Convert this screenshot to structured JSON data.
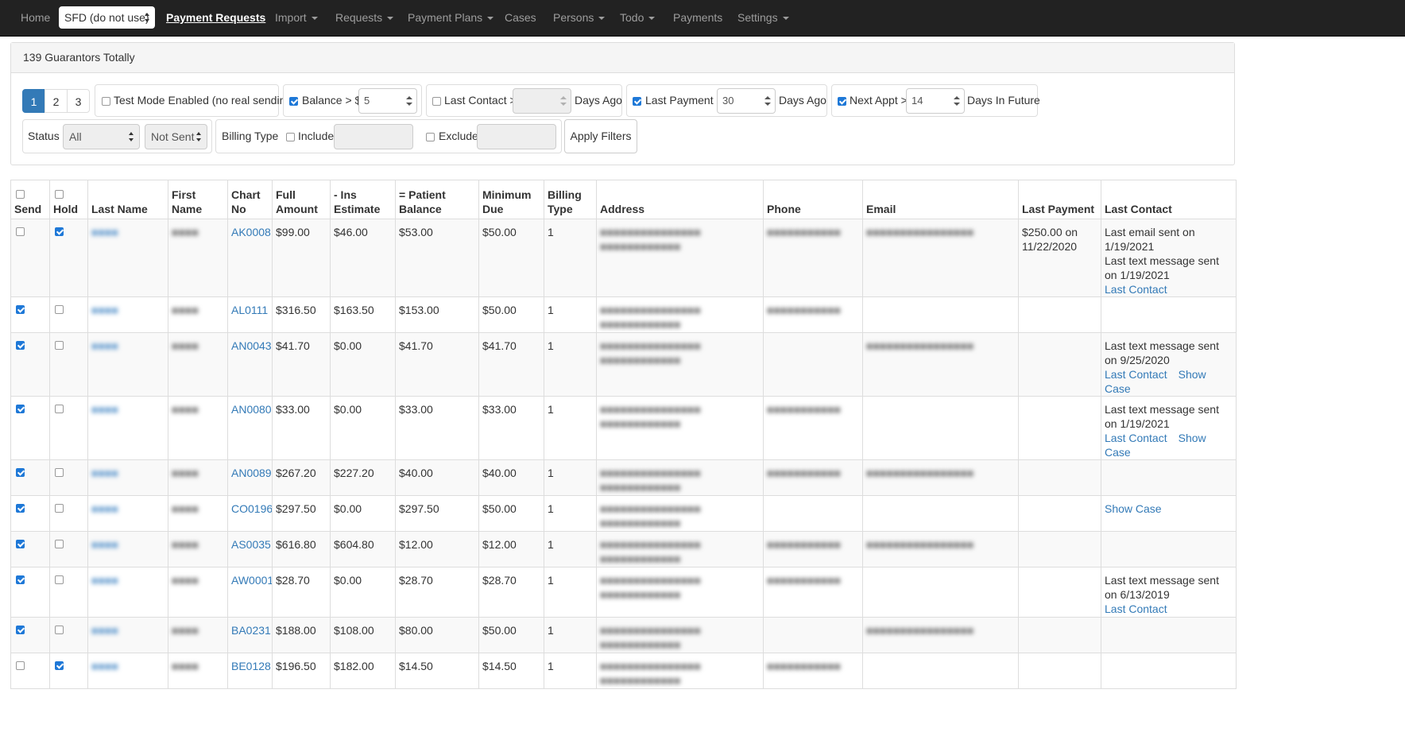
{
  "nav": {
    "home": "Home",
    "site_select": "SFD (do not use)",
    "payment_requests": "Payment Requests",
    "import": "Import",
    "requests": "Requests",
    "payment_plans": "Payment Plans",
    "cases": "Cases",
    "persons": "Persons",
    "todo": "Todo",
    "payments": "Payments",
    "settings": "Settings"
  },
  "panel": {
    "heading": "139 Guarantors Totally",
    "pages": [
      "1",
      "2",
      "3"
    ],
    "active_page": "1",
    "test_mode": {
      "label": "Test Mode Enabled (no real sending)",
      "checked": false
    },
    "balance": {
      "label": "Balance > $",
      "value": "5",
      "checked": true
    },
    "last_contact": {
      "label": "Last Contact >",
      "value": "",
      "suffix": "Days Ago",
      "checked": false
    },
    "last_payment": {
      "label": "Last Payment >",
      "value": "30",
      "suffix": "Days Ago",
      "checked": true
    },
    "next_appt": {
      "label": "Next Appt >",
      "value": "14",
      "suffix": "Days In Future",
      "checked": true
    },
    "status": {
      "label": "Status",
      "value": "All",
      "send_value": "Not Sent"
    },
    "billing_type": {
      "label": "Billing Type",
      "include_label": "Include",
      "exclude_label": "Exclude"
    },
    "apply": "Apply Filters"
  },
  "table": {
    "headers": {
      "send": "Send",
      "hold": "Hold",
      "last_name": "Last Name",
      "first_name": "First Name",
      "chart_no_1": "Chart",
      "chart_no_2": "No",
      "full_amount_1": "Full",
      "full_amount_2": "Amount",
      "ins_estimate_1": "- Ins",
      "ins_estimate_2": "Estimate",
      "patient_balance_1": "= Patient",
      "patient_balance_2": "Balance",
      "minimum_due_1": "Minimum",
      "minimum_due_2": "Due",
      "billing_type_1": "Billing",
      "billing_type_2": "Type",
      "address": "Address",
      "phone": "Phone",
      "email": "Email",
      "last_payment": "Last Payment",
      "last_contact": "Last Contact"
    },
    "rows": [
      {
        "send": false,
        "hold": true,
        "chart": "AK0008",
        "full": "$99.00",
        "ins": "$46.00",
        "patient": "$53.00",
        "min": "$50.00",
        "billing": "1",
        "last_payment": "$250.00 on 11/22/2020",
        "contact_lines": [
          "Last email sent on 1/19/2021",
          "Last text message sent on 1/19/2021"
        ],
        "links": [
          "Last Contact"
        ]
      },
      {
        "send": true,
        "hold": false,
        "chart": "AL0111",
        "full": "$316.50",
        "ins": "$163.50",
        "patient": "$153.00",
        "min": "$50.00",
        "billing": "1",
        "last_payment": "",
        "contact_lines": [],
        "links": []
      },
      {
        "send": true,
        "hold": false,
        "chart": "AN0043",
        "full": "$41.70",
        "ins": "$0.00",
        "patient": "$41.70",
        "min": "$41.70",
        "billing": "1",
        "last_payment": "",
        "contact_lines": [
          "Last text message sent on 9/25/2020"
        ],
        "links": [
          "Last Contact",
          "Show Case"
        ]
      },
      {
        "send": true,
        "hold": false,
        "chart": "AN0080",
        "full": "$33.00",
        "ins": "$0.00",
        "patient": "$33.00",
        "min": "$33.00",
        "billing": "1",
        "last_payment": "",
        "contact_lines": [
          "Last text message sent on 1/19/2021"
        ],
        "links": [
          "Last Contact",
          "Show Case"
        ]
      },
      {
        "send": true,
        "hold": false,
        "chart": "AN0089",
        "full": "$267.20",
        "ins": "$227.20",
        "patient": "$40.00",
        "min": "$40.00",
        "billing": "1",
        "last_payment": "",
        "contact_lines": [],
        "links": []
      },
      {
        "send": true,
        "hold": false,
        "chart": "CO0196",
        "full": "$297.50",
        "ins": "$0.00",
        "patient": "$297.50",
        "min": "$50.00",
        "billing": "1",
        "last_payment": "",
        "contact_lines": [],
        "links": [
          "Show Case"
        ]
      },
      {
        "send": true,
        "hold": false,
        "chart": "AS0035",
        "full": "$616.80",
        "ins": "$604.80",
        "patient": "$12.00",
        "min": "$12.00",
        "billing": "1",
        "last_payment": "",
        "contact_lines": [],
        "links": []
      },
      {
        "send": true,
        "hold": false,
        "chart": "AW0001",
        "full": "$28.70",
        "ins": "$0.00",
        "patient": "$28.70",
        "min": "$28.70",
        "billing": "1",
        "last_payment": "",
        "contact_lines": [
          "Last text message sent on 6/13/2019"
        ],
        "links": [
          "Last Contact"
        ]
      },
      {
        "send": true,
        "hold": false,
        "chart": "BA0231",
        "full": "$188.00",
        "ins": "$108.00",
        "patient": "$80.00",
        "min": "$50.00",
        "billing": "1",
        "last_payment": "",
        "contact_lines": [],
        "links": []
      },
      {
        "send": false,
        "hold": true,
        "chart": "BE0128",
        "full": "$196.50",
        "ins": "$182.00",
        "patient": "$14.50",
        "min": "$14.50",
        "billing": "1",
        "last_payment": "",
        "contact_lines": [],
        "links": []
      }
    ]
  }
}
